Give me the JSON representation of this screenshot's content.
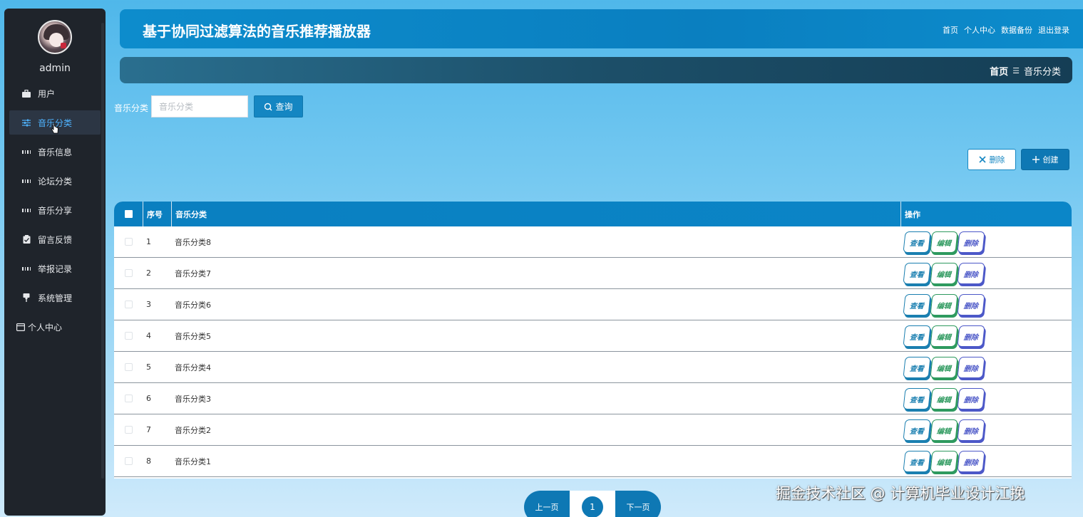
{
  "sidebar": {
    "username": "admin",
    "items": [
      {
        "label": "用户",
        "icon": "briefcase-icon"
      },
      {
        "label": "音乐分类",
        "icon": "sliders-icon",
        "active": true
      },
      {
        "label": "音乐信息",
        "icon": "grid-icon"
      },
      {
        "label": "论坛分类",
        "icon": "grid-icon"
      },
      {
        "label": "音乐分享",
        "icon": "grid-icon"
      },
      {
        "label": "留言反馈",
        "icon": "clipboard-check-icon"
      },
      {
        "label": "举报记录",
        "icon": "grid-icon"
      },
      {
        "label": "系统管理",
        "icon": "pushpin-icon"
      },
      {
        "label": "个人中心",
        "icon": "window-icon"
      }
    ]
  },
  "header": {
    "title": "基于协同过滤算法的音乐推荐播放器",
    "nav": [
      "首页",
      "个人中心",
      "数据备份",
      "退出登录"
    ]
  },
  "breadcrumb": {
    "home": "首页",
    "separator": "☰",
    "current": "音乐分类"
  },
  "search": {
    "label": "音乐分类",
    "placeholder": "音乐分类",
    "value": "",
    "button": "查询"
  },
  "actions": {
    "delete": "删除",
    "create": "创建"
  },
  "table": {
    "headers": {
      "index": "序号",
      "name": "音乐分类",
      "ops": "操作"
    },
    "rows": [
      {
        "index": "1",
        "name": "音乐分类8"
      },
      {
        "index": "2",
        "name": "音乐分类7"
      },
      {
        "index": "3",
        "name": "音乐分类6"
      },
      {
        "index": "4",
        "name": "音乐分类5"
      },
      {
        "index": "5",
        "name": "音乐分类4"
      },
      {
        "index": "6",
        "name": "音乐分类3"
      },
      {
        "index": "7",
        "name": "音乐分类2"
      },
      {
        "index": "8",
        "name": "音乐分类1"
      }
    ],
    "row_ops": {
      "view": "查看",
      "edit": "编辑",
      "delete": "删除"
    }
  },
  "pagination": {
    "prev": "上一页",
    "current": "1",
    "next": "下一页"
  },
  "watermark": "掘金技术社区 @ 计算机毕业设计江挽",
  "colors": {
    "primary": "#0e78b4",
    "sidebar": "#1f242b",
    "active_text": "#4fb3ff"
  }
}
